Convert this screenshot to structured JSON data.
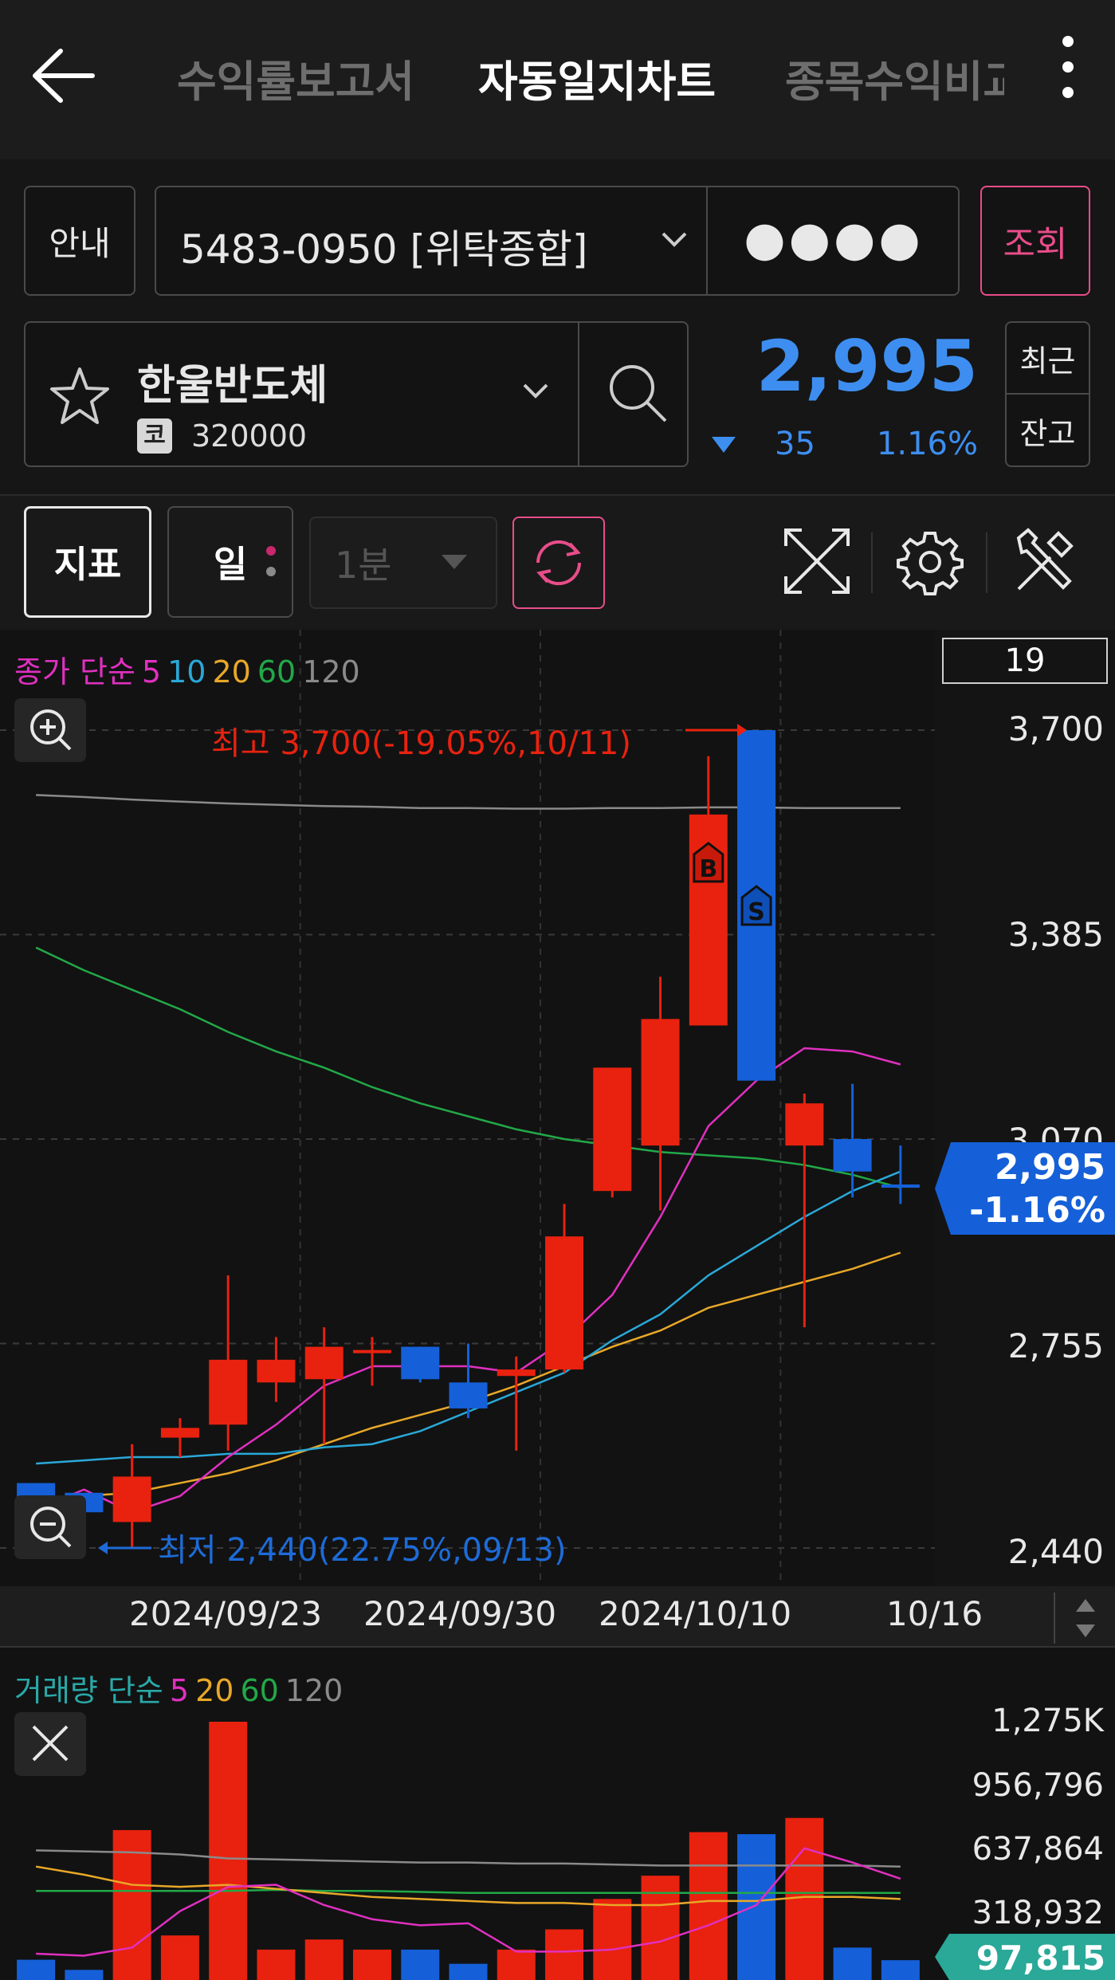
{
  "header": {
    "tabs": [
      "수익률보고서",
      "자동일지차트",
      "종목수익비교"
    ],
    "active_tab": "자동일지차트"
  },
  "account": {
    "guide_label": "안내",
    "number": "5483-0950 [위탁종합]",
    "password_mask": "●●●●",
    "query_label": "조회"
  },
  "stock": {
    "name": "한울반도체",
    "market_badge": "코",
    "code": "320000",
    "price": "2,995",
    "change": "35",
    "change_pct": "1.16%",
    "recent_label": "최근",
    "balance_label": "잔고"
  },
  "toolbar": {
    "indicator_label": "지표",
    "period_label": "일",
    "interval_label": "1분"
  },
  "colors": {
    "up": "#e8220f",
    "down": "#1560d8",
    "accent": "#e84d8a",
    "price_blue": "#3d8ef0",
    "ma5": "#e030c0",
    "ma10": "#2aa8d8",
    "ma20": "#e8a828",
    "ma60": "#22a848",
    "ma120": "#8a8a8a"
  },
  "price_legend": {
    "title": "종가 단순",
    "periods": [
      "5",
      "10",
      "20",
      "60",
      "120"
    ]
  },
  "volume_legend": {
    "title": "거래량 단순",
    "periods": [
      "5",
      "20",
      "60",
      "120"
    ]
  },
  "candle_count": "19",
  "current_tag": {
    "price": "2,995",
    "pct": "-1.16%"
  },
  "volume_tag": "97,815",
  "annotations": {
    "high": "최고 3,700(-19.05%,10/11)",
    "low": "최저 2,440(22.75%,09/13)"
  },
  "chart_data": {
    "type": "candlestick",
    "ylim": [
      2440,
      3700
    ],
    "y_ticks": [
      "3,700",
      "3,385",
      "3,070",
      "2,755",
      "2,440"
    ],
    "x_ticks": [
      "2024/09/23",
      "2024/09/30",
      "2024/10/10",
      "10/16"
    ],
    "candles": [
      {
        "o": 2540,
        "h": 2540,
        "l": 2460,
        "c": 2465
      },
      {
        "o": 2525,
        "h": 2525,
        "l": 2480,
        "c": 2495
      },
      {
        "o": 2480,
        "h": 2600,
        "l": 2440,
        "c": 2550
      },
      {
        "o": 2610,
        "h": 2640,
        "l": 2580,
        "c": 2625
      },
      {
        "o": 2630,
        "h": 2860,
        "l": 2590,
        "c": 2730
      },
      {
        "o": 2695,
        "h": 2765,
        "l": 2665,
        "c": 2730
      },
      {
        "o": 2700,
        "h": 2780,
        "l": 2600,
        "c": 2750
      },
      {
        "o": 2745,
        "h": 2765,
        "l": 2690,
        "c": 2745
      },
      {
        "o": 2750,
        "h": 2745,
        "l": 2695,
        "c": 2700
      },
      {
        "o": 2695,
        "h": 2755,
        "l": 2640,
        "c": 2655
      },
      {
        "o": 2705,
        "h": 2735,
        "l": 2590,
        "c": 2715
      },
      {
        "o": 2715,
        "h": 2970,
        "l": 2710,
        "c": 2920
      },
      {
        "o": 2990,
        "h": 3050,
        "l": 2980,
        "c": 3180
      },
      {
        "o": 3060,
        "h": 3320,
        "l": 2960,
        "c": 3255
      },
      {
        "o": 3245,
        "h": 3660,
        "l": 3245,
        "c": 3570
      },
      {
        "o": 3700,
        "h": 3700,
        "l": 3160,
        "c": 3160
      },
      {
        "o": 3060,
        "h": 3140,
        "l": 2780,
        "c": 3125
      },
      {
        "o": 3070,
        "h": 3155,
        "l": 2980,
        "c": 3020
      },
      {
        "o": 3000,
        "h": 3060,
        "l": 2970,
        "c": 2995
      }
    ],
    "markers": [
      {
        "index": 14,
        "label": "B"
      },
      {
        "index": 15,
        "label": "S"
      }
    ],
    "ma": {
      "ma5": [
        2500,
        2530,
        2495,
        2520,
        2580,
        2630,
        2690,
        2720,
        2720,
        2720,
        2710,
        2760,
        2830,
        2950,
        3090,
        3160,
        3210,
        3205,
        3185
      ],
      "ma10": [
        2570,
        2575,
        2580,
        2580,
        2585,
        2585,
        2595,
        2600,
        2620,
        2650,
        2680,
        2710,
        2760,
        2800,
        2860,
        2905,
        2950,
        2990,
        3020
      ],
      "ma20": [
        2510,
        2520,
        2525,
        2540,
        2555,
        2575,
        2600,
        2625,
        2645,
        2665,
        2690,
        2720,
        2750,
        2775,
        2810,
        2830,
        2850,
        2870,
        2895
      ],
      "ma60": [
        3365,
        3330,
        3300,
        3270,
        3235,
        3205,
        3180,
        3150,
        3125,
        3105,
        3085,
        3070,
        3060,
        3050,
        3045,
        3040,
        3030,
        3015,
        2995
      ],
      "ma120": [
        3600,
        3597,
        3593,
        3590,
        3587,
        3585,
        3583,
        3582,
        3580,
        3580,
        3579,
        3579,
        3580,
        3580,
        3581,
        3581,
        3580,
        3580,
        3580
      ]
    },
    "volume": {
      "ylim": [
        0,
        1275000
      ],
      "y_ticks": [
        "1,275K",
        "956,796",
        "637,864",
        "318,932"
      ],
      "values": [
        100000,
        50000,
        740000,
        220000,
        1275000,
        150000,
        200000,
        150000,
        150000,
        80000,
        150000,
        250000,
        400000,
        515000,
        730000,
        720000,
        800000,
        160000,
        97815
      ],
      "ma5": [
        130000,
        120000,
        160000,
        340000,
        460000,
        470000,
        370000,
        300000,
        270000,
        280000,
        140000,
        140000,
        150000,
        190000,
        270000,
        370000,
        650000,
        580000,
        500000
      ],
      "ma20": [
        560000,
        520000,
        470000,
        460000,
        470000,
        450000,
        430000,
        410000,
        400000,
        390000,
        380000,
        380000,
        370000,
        370000,
        390000,
        390000,
        410000,
        410000,
        400000
      ],
      "ma60": [
        440000,
        440000,
        440000,
        440000,
        440000,
        445000,
        440000,
        440000,
        435000,
        430000,
        430000,
        430000,
        430000,
        430000,
        430000,
        430000,
        430000,
        430000,
        430000
      ],
      "ma120": [
        640000,
        635000,
        630000,
        620000,
        600000,
        595000,
        590000,
        585000,
        580000,
        580000,
        575000,
        575000,
        570000,
        565000,
        565000,
        565000,
        565000,
        565000,
        560000
      ]
    }
  }
}
